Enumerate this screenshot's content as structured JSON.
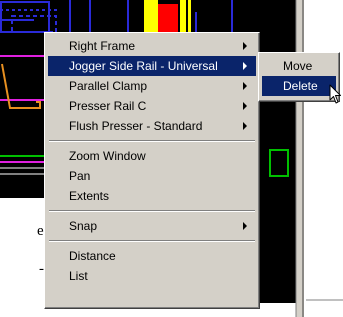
{
  "stray_text": {
    "line1": "e",
    "line2": "-"
  },
  "context_menu": {
    "items": [
      {
        "label": "Right Frame",
        "submenu": true
      },
      {
        "label": "Jogger Side Rail - Universal",
        "submenu": true,
        "highlighted": true
      },
      {
        "label": "Parallel Clamp",
        "submenu": true
      },
      {
        "label": "Presser Rail C",
        "submenu": true
      },
      {
        "label": "Flush Presser - Standard",
        "submenu": true
      },
      {
        "label": "Zoom Window",
        "submenu": false
      },
      {
        "label": "Pan",
        "submenu": false
      },
      {
        "label": "Extents",
        "submenu": false
      },
      {
        "label": "Snap",
        "submenu": true
      },
      {
        "label": "Distance",
        "submenu": false
      },
      {
        "label": "List",
        "submenu": false
      }
    ]
  },
  "submenu": {
    "items": [
      {
        "label": "Move",
        "highlighted": false
      },
      {
        "label": "Delete",
        "highlighted": true
      }
    ]
  },
  "colors": {
    "canvas_background": "#000000",
    "menu_face": "#d4d0c8",
    "menu_highlight": "#0a246a",
    "cad_blue": "#2a2ad8",
    "cad_yellow": "#ffff00",
    "cad_red": "#ff0000",
    "cad_green": "#00c000",
    "cad_magenta": "#e020e0",
    "cad_orange": "#e89020"
  }
}
